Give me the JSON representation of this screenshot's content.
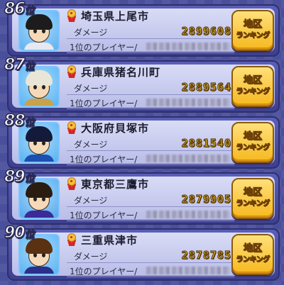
{
  "rank_suffix": "位",
  "labels": {
    "damage": "ダメージ",
    "top_player": "1位のプレイヤー/"
  },
  "button": {
    "line1": "地区",
    "line2": "ランキング"
  },
  "rows": [
    {
      "rank": "86",
      "area": "埼玉県上尾市",
      "damage": "2899608",
      "player_name": "",
      "avatar": {
        "hair": "#1c1c1c",
        "shirt": "#e8e8f0",
        "bg": "#5eb0f0"
      }
    },
    {
      "rank": "87",
      "area": "兵庫県猪名川町",
      "damage": "2889564",
      "player_name": "",
      "avatar": {
        "hair": "#e9e6d8",
        "shirt": "#c9a24a",
        "bg": "#58b4f2"
      }
    },
    {
      "rank": "88",
      "area": "大阪府貝塚市",
      "damage": "2881540",
      "player_name": "",
      "avatar": {
        "hair": "#141a3a",
        "shirt": "#1d4fb0",
        "bg": "#5ab2f0"
      }
    },
    {
      "rank": "89",
      "area": "東京都三鷹市",
      "damage": "2879905",
      "player_name": "",
      "avatar": {
        "hair": "#2a1c10",
        "shirt": "#3b2a9a",
        "bg": "#56a8ea"
      }
    },
    {
      "rank": "90",
      "area": "三重県津市",
      "damage": "2878785",
      "player_name": "",
      "avatar": {
        "hair": "#5a3212",
        "shirt": "#2a2f8a",
        "bg": "#5cb3f0"
      }
    }
  ]
}
